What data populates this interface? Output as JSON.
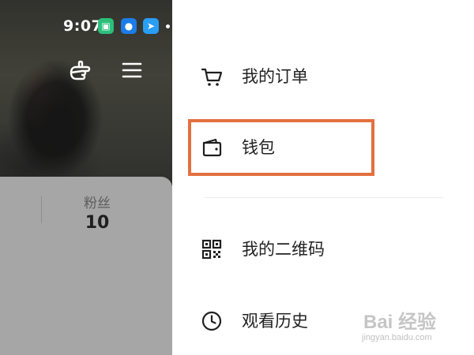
{
  "status_bar": {
    "time": "9:07",
    "icons": [
      "xiaomi-app-icon",
      "qq-penguin-icon",
      "feishu-arrow-icon"
    ]
  },
  "profile": {
    "header_icons": [
      "pointing-hand-icon",
      "hamburger-menu-icon"
    ],
    "stats": {
      "fans_label": "粉丝",
      "fans_count": "10"
    }
  },
  "drawer": {
    "items": [
      {
        "label": "我的订单",
        "icon": "shopping-cart-icon"
      },
      {
        "label": "钱包",
        "icon": "wallet-icon",
        "highlighted": true
      },
      {
        "label": "我的二维码",
        "icon": "qr-code-icon"
      },
      {
        "label": "观看历史",
        "icon": "clock-icon"
      }
    ],
    "highlight_color": "#e3703f"
  },
  "watermark": {
    "text": "Bai 经验",
    "sub": "jingyan.baidu.com"
  }
}
